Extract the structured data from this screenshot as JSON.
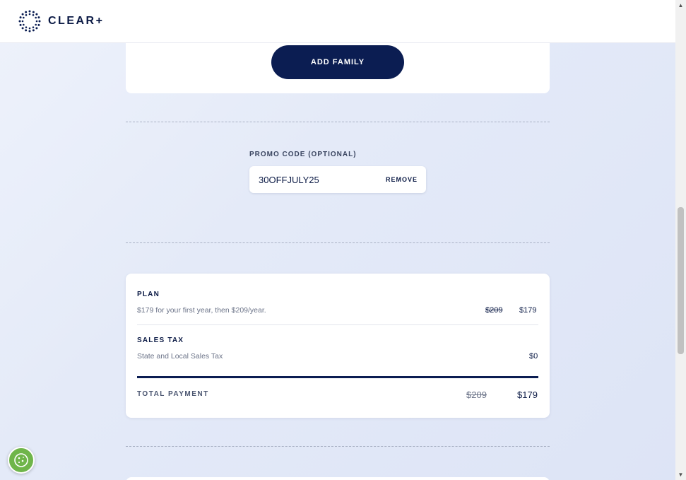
{
  "header": {
    "brand": "CLEAR",
    "brand_plus": "+",
    "logo_icon": "clear-dots-logo-icon"
  },
  "family": {
    "faded_text": "",
    "add_family_label": "ADD FAMILY"
  },
  "promo": {
    "label": "PROMO CODE (OPTIONAL)",
    "code": "30OFFJULY25",
    "remove_label": "REMOVE"
  },
  "summary": {
    "plan_label": "PLAN",
    "plan_desc": "$179 for your first year, then $209/year.",
    "plan_old_price": "$209",
    "plan_price": "$179",
    "tax_label": "SALES TAX",
    "tax_desc": "State and Local Sales Tax",
    "tax_price": "$0",
    "total_label": "TOTAL PAYMENT",
    "total_old_price": "$209",
    "total_price": "$179"
  },
  "cookie": {
    "icon": "cookie-icon"
  },
  "colors": {
    "navy": "#0b1d52",
    "cookie_green": "#6fb54a",
    "background": "#e4eaf8"
  }
}
